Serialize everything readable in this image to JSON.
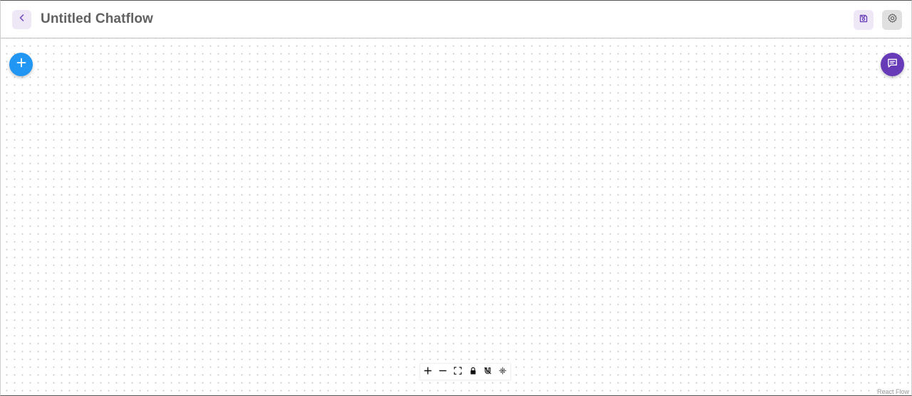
{
  "header": {
    "title": "Untitled Chatflow",
    "back_icon": "chevron-left-icon",
    "save_icon": "save-icon",
    "settings_icon": "gear-icon"
  },
  "canvas": {
    "add_node_icon": "plus-icon",
    "chat_icon": "chat-message-icon",
    "controls": [
      {
        "name": "zoom-in-button",
        "icon": "plus-icon"
      },
      {
        "name": "zoom-out-button",
        "icon": "minus-icon"
      },
      {
        "name": "fit-view-button",
        "icon": "fit-view-icon"
      },
      {
        "name": "toggle-interactivity-button",
        "icon": "lock-icon"
      },
      {
        "name": "toggle-snap-button",
        "icon": "magnet-icon"
      },
      {
        "name": "toggle-background-button",
        "icon": "dots-grid-icon"
      }
    ],
    "attribution": "React Flow"
  },
  "colors": {
    "primary_blue": "#2196f3",
    "secondary_purple": "#673ab7",
    "purple_light": "#ede7f6",
    "title_gray": "#616161"
  }
}
